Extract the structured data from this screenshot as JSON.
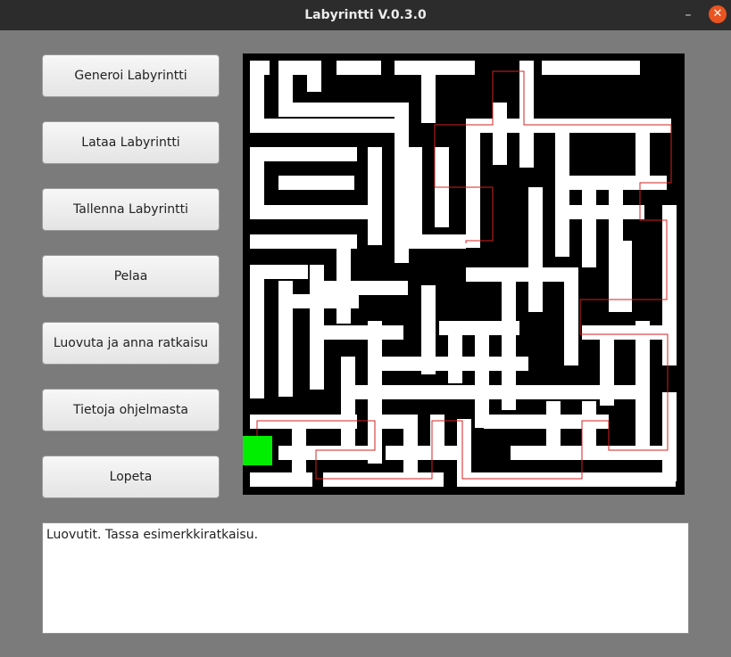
{
  "window": {
    "title": "Labyrintti V.0.3.0",
    "minimize_glyph": "–",
    "close_glyph": "✕"
  },
  "buttons": [
    {
      "label": "Generoi Labyrintti"
    },
    {
      "label": "Lataa Labyrintti"
    },
    {
      "label": "Tallenna Labyrintti"
    },
    {
      "label": "Pelaa"
    },
    {
      "label": "Luovuta ja anna ratkaisu"
    },
    {
      "label": "Tietoja ohjelmasta"
    },
    {
      "label": "Lopeta"
    }
  ],
  "output": {
    "text": "Luovutit. Tassa esimerkkiratkaisu."
  },
  "maze": {
    "wall_color": "#000000",
    "path_color": "#ffffff",
    "solution_color": "#d42020",
    "player_color": "#00ee00"
  }
}
